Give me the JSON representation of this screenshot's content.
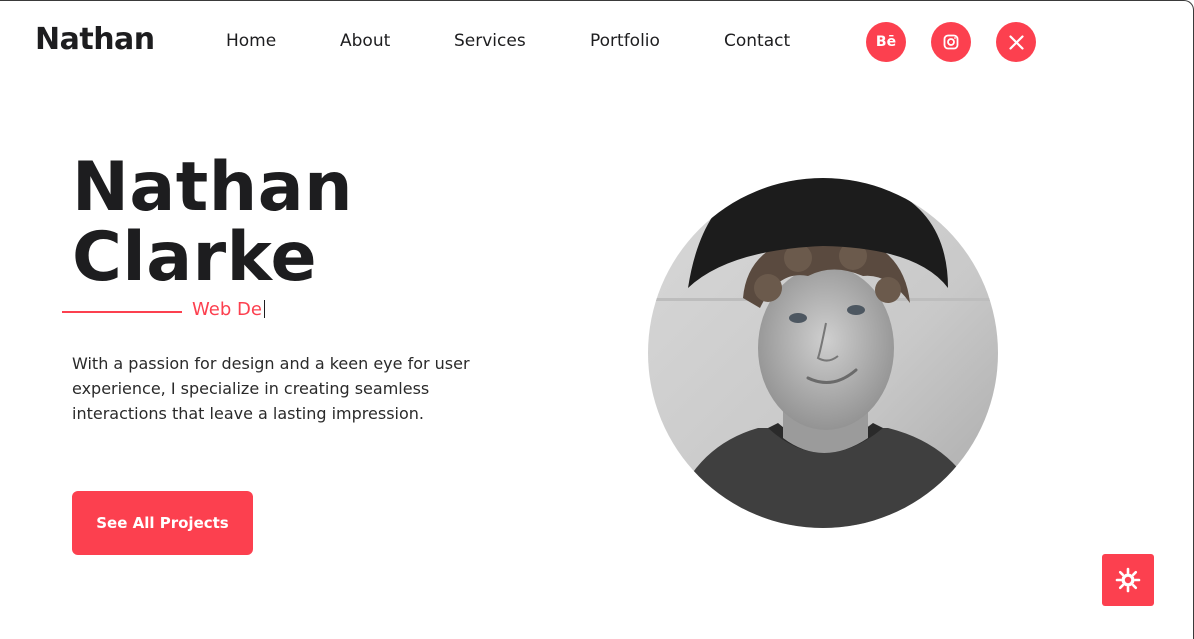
{
  "header": {
    "logo": "Nathan",
    "nav": [
      "Home",
      "About",
      "Services",
      "Portfolio",
      "Contact"
    ],
    "social": [
      {
        "label": "Bē",
        "icon": "behance-icon"
      },
      {
        "label": "",
        "icon": "instagram-icon"
      },
      {
        "label": "",
        "icon": "x-twitter-icon"
      }
    ]
  },
  "hero": {
    "first_name": "Nathan",
    "last_name": "Clarke",
    "role_typed": "Web De",
    "bio_lines": [
      "With a passion for design and a keen eye for user",
      "experience, I specialize in creating seamless",
      "interactions that leave a lasting impression."
    ],
    "cta_label": "See All Projects",
    "portrait_icon": "portrait-photo"
  },
  "fab": {
    "icon": "sun-gear-icon"
  },
  "colors": {
    "accent": "#fc404f",
    "text": "#1d1d1f",
    "background": "#ffffff"
  }
}
